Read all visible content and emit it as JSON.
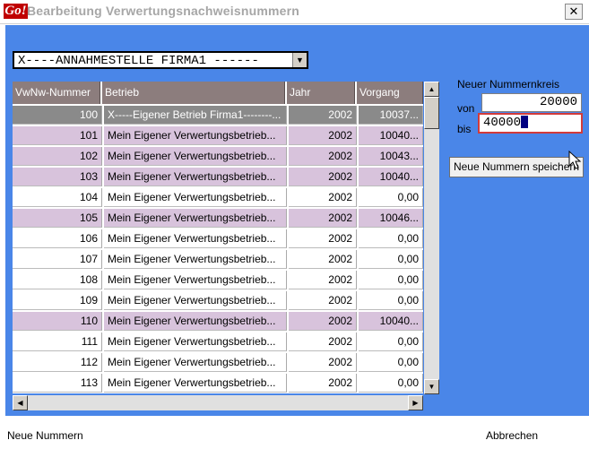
{
  "window": {
    "title": "Bearbeitung Verwertungsnachweisnummern",
    "logo_text": "Go!"
  },
  "combo": {
    "value": "X----ANNAHMESTELLE FIRMA1 ------"
  },
  "grid": {
    "headers": [
      "VwNw-Nummer",
      "Betrieb",
      "Jahr",
      "Vorgang"
    ],
    "rows": [
      {
        "nr": "100",
        "betrieb": "X-----Eigener Betrieb Firma1--------...",
        "jahr": "2002",
        "vorgang": "10037...",
        "style": "sel"
      },
      {
        "nr": "101",
        "betrieb": "Mein Eigener Verwertungsbetrieb...",
        "jahr": "2002",
        "vorgang": "10040...",
        "style": "purple"
      },
      {
        "nr": "102",
        "betrieb": "Mein Eigener Verwertungsbetrieb...",
        "jahr": "2002",
        "vorgang": "10043...",
        "style": "purple"
      },
      {
        "nr": "103",
        "betrieb": "Mein Eigener Verwertungsbetrieb...",
        "jahr": "2002",
        "vorgang": "10040...",
        "style": "purple"
      },
      {
        "nr": "104",
        "betrieb": "Mein Eigener Verwertungsbetrieb...",
        "jahr": "2002",
        "vorgang": "0,00",
        "style": "white"
      },
      {
        "nr": "105",
        "betrieb": "Mein Eigener Verwertungsbetrieb...",
        "jahr": "2002",
        "vorgang": "10046...",
        "style": "purple"
      },
      {
        "nr": "106",
        "betrieb": "Mein Eigener Verwertungsbetrieb...",
        "jahr": "2002",
        "vorgang": "0,00",
        "style": "white"
      },
      {
        "nr": "107",
        "betrieb": "Mein Eigener Verwertungsbetrieb...",
        "jahr": "2002",
        "vorgang": "0,00",
        "style": "white"
      },
      {
        "nr": "108",
        "betrieb": "Mein Eigener Verwertungsbetrieb...",
        "jahr": "2002",
        "vorgang": "0,00",
        "style": "white"
      },
      {
        "nr": "109",
        "betrieb": "Mein Eigener Verwertungsbetrieb...",
        "jahr": "2002",
        "vorgang": "0,00",
        "style": "white"
      },
      {
        "nr": "110",
        "betrieb": "Mein Eigener Verwertungsbetrieb...",
        "jahr": "2002",
        "vorgang": "10040...",
        "style": "purple"
      },
      {
        "nr": "111",
        "betrieb": "Mein Eigener Verwertungsbetrieb...",
        "jahr": "2002",
        "vorgang": "0,00",
        "style": "white"
      },
      {
        "nr": "112",
        "betrieb": "Mein Eigener Verwertungsbetrieb...",
        "jahr": "2002",
        "vorgang": "0,00",
        "style": "white"
      },
      {
        "nr": "113",
        "betrieb": "Mein Eigener Verwertungsbetrieb...",
        "jahr": "2002",
        "vorgang": "0,00",
        "style": "white"
      }
    ]
  },
  "range": {
    "heading": "Neuer Nummernkreis",
    "from_label": "von",
    "from_value": "20000",
    "to_label": "bis",
    "to_value": "40000",
    "save_label": "Neue Nummern speichern"
  },
  "footer": {
    "new_numbers": "Neue Nummern",
    "cancel": "Abbrechen"
  },
  "colors": {
    "panel": "#4a86e8",
    "row_highlight": "#d8c3dc",
    "selected_row": "#8a8a8a",
    "header": "#8c7d7d"
  }
}
